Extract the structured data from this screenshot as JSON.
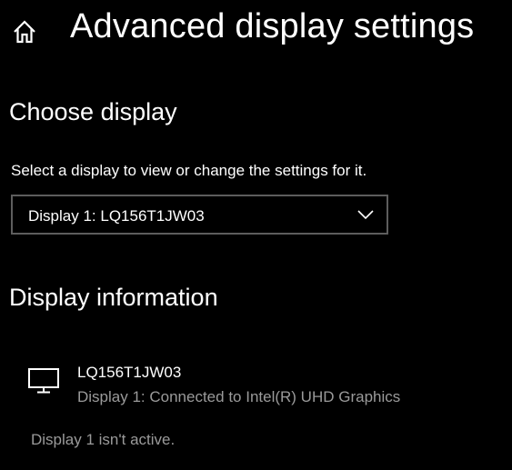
{
  "header": {
    "title": "Advanced display settings",
    "home_icon": "home-icon"
  },
  "choose_display": {
    "section_title": "Choose display",
    "description": "Select a display to view or change the settings for it.",
    "selected_display": "Display 1: LQ156T1JW03",
    "dropdown_icon": "chevron-down-icon"
  },
  "display_information": {
    "section_title": "Display information",
    "monitor_icon": "monitor-icon",
    "device_name": "LQ156T1JW03",
    "connection": "Display 1: Connected to Intel(R) UHD Graphics",
    "status": "Display 1 isn't active."
  },
  "colors": {
    "background": "#000000",
    "text": "#ffffff",
    "secondary_text": "#9a9a9a",
    "dropdown_border": "#5d5d5d"
  }
}
